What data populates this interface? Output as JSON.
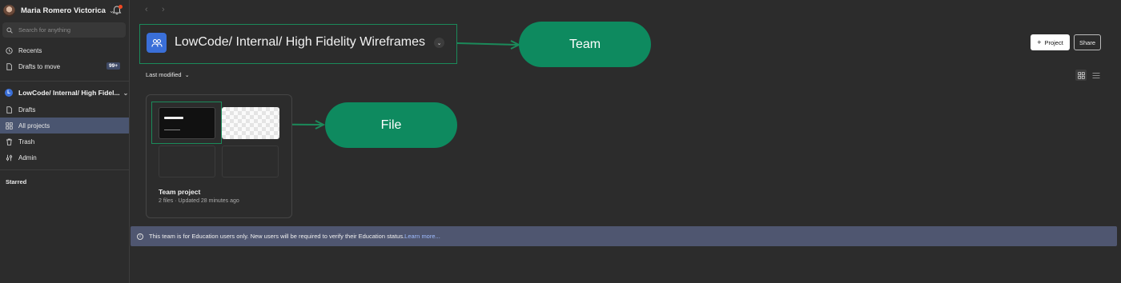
{
  "sidebar": {
    "user_name": "Maria Romero Victorica",
    "search_placeholder": "Search for anything",
    "nav_top": [
      {
        "label": "Recents",
        "icon": "clock-icon"
      },
      {
        "label": "Drafts to move",
        "icon": "file-icon",
        "badge": "99+"
      }
    ],
    "team_name": "LowCode/ Internal/ High Fidel...",
    "team_initial": "L",
    "nav_team": [
      {
        "label": "Drafts",
        "icon": "file-icon"
      },
      {
        "label": "All projects",
        "icon": "grid-icon",
        "active": true
      },
      {
        "label": "Trash",
        "icon": "trash-icon"
      },
      {
        "label": "Admin",
        "icon": "sliders-icon"
      }
    ],
    "starred_label": "Starred"
  },
  "header": {
    "team_title": "LowCode/ Internal/ High Fidelity Wireframes",
    "project_button": "Project",
    "share_button": "Share"
  },
  "annotations": {
    "team_label": "Team",
    "file_label": "File",
    "accent_color": "#0e8a5f"
  },
  "toolbar": {
    "sort_label": "Last modified"
  },
  "project_card": {
    "title": "Team project",
    "meta": "2 files · Updated 28 minutes ago"
  },
  "banner": {
    "text": "This team is for Education users only. New users will be required to verify their Education status.",
    "link": "Learn more..."
  }
}
